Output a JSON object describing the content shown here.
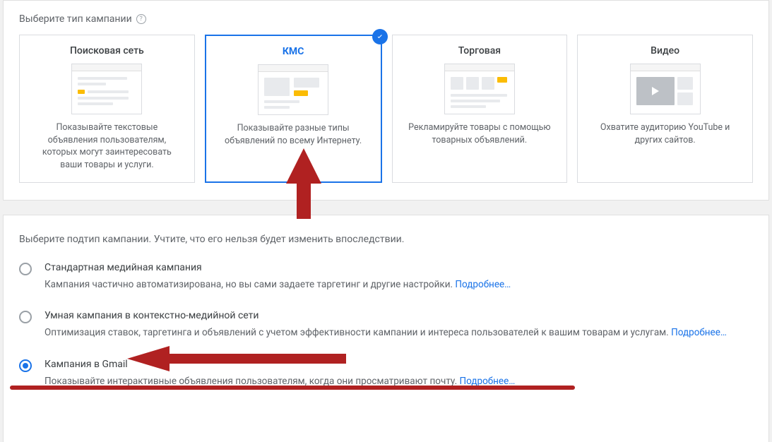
{
  "typeSection": {
    "title": "Выберите тип кампании",
    "cards": [
      {
        "title": "Поисковая сеть",
        "desc": "Показывайте текстовые объявления пользователям, которых могут заинтересовать ваши товары и услуги."
      },
      {
        "title": "КМС",
        "desc": "Показывайте разные типы объявлений по всему Интернету."
      },
      {
        "title": "Торговая",
        "desc": "Рекламируйте товары с помощью товарных объявлений."
      },
      {
        "title": "Видео",
        "desc": "Охватите аудиторию YouTube и других сайтов."
      }
    ],
    "selectedIndex": 1
  },
  "subtypeSection": {
    "intro": "Выберите подтип кампании. Учтите, что его нельзя будет изменить впоследствии.",
    "items": [
      {
        "title": "Стандартная медийная кампания",
        "desc": "Кампания частично автоматизирована, но вы сами задаете таргетинг и другие настройки.",
        "learnMore": "Подробнее…"
      },
      {
        "title": "Умная кампания в контекстно-медийной сети",
        "desc": "Оптимизация ставок, таргетинга и объявлений с учетом эффективности кампании и интереса пользователей к вашим товарам и услугам.",
        "learnMore": "Подробнее…"
      },
      {
        "title": "Кампания в Gmail",
        "desc": "Показывайте интерактивные объявления пользователям, когда они просматривают почту.",
        "learnMore": "Подробнее…"
      }
    ],
    "selectedIndex": 2
  },
  "annotation": {
    "color": "#b02121"
  }
}
